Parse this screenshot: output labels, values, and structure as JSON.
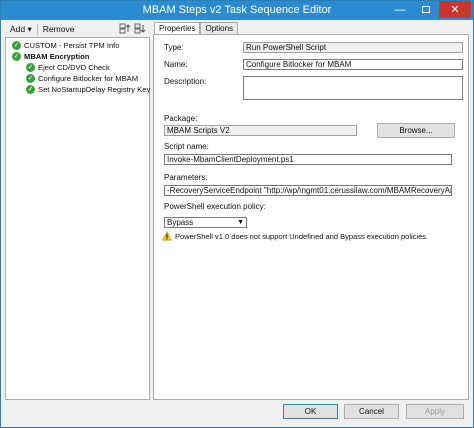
{
  "window": {
    "title": "MBAM Steps v2 Task Sequence Editor",
    "minimize_glyph": "—",
    "close_glyph": "✕"
  },
  "toolbar": {
    "add_label": "Add",
    "add_caret": "▾",
    "remove_label": "Remove"
  },
  "tree": {
    "items": [
      {
        "label": "CUSTOM - Persist TPM Info",
        "level": 0,
        "bold": false
      },
      {
        "label": "MBAM Encryption",
        "level": 0,
        "bold": true
      },
      {
        "label": "Eject CD/DVD Check",
        "level": 1,
        "bold": false
      },
      {
        "label": "Configure Bitlocker for MBAM",
        "level": 1,
        "bold": false
      },
      {
        "label": "Set NoStartupDelay Registry Key",
        "level": 1,
        "bold": false
      }
    ]
  },
  "tabs": {
    "properties": "Properties",
    "options": "Options"
  },
  "properties": {
    "type_label": "Type:",
    "type_value": "Run PowerShell Script",
    "name_label": "Name:",
    "name_value": "Configure Bitlocker for MBAM",
    "description_label": "Description:",
    "description_value": "",
    "package_label": "Package:",
    "package_value": "MBAM Scripts V2",
    "browse_label": "Browse...",
    "script_name_label": "Script name:",
    "script_name_value": "Invoke-MbamClientDeployment.ps1",
    "parameters_label": "Parameters:",
    "parameters_value": "-RecoveryServiceEndpoint  \"http://wp/\\ngmt01.cerussilaw.com/MBAMRecoveryAndHardw",
    "policy_label": "PowerShell execution policy:",
    "policy_value": "Bypass",
    "warning_text": "PowerShell v1.0 does not support Undefined and Bypass execution policies."
  },
  "footer": {
    "ok_label": "OK",
    "cancel_label": "Cancel",
    "apply_label": "Apply"
  }
}
